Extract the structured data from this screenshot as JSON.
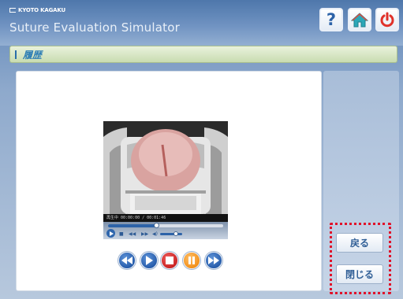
{
  "header": {
    "brand": "KYOTO KAGAKU",
    "title": "Suture Evaluation Simulator",
    "help_label": "?"
  },
  "section": {
    "title": "履歴"
  },
  "video": {
    "status": "再生中 00:00:00 / 00:01:46"
  },
  "playback": {
    "progress": 0.42,
    "volume": 0.7
  },
  "side_buttons": {
    "back_label": "戻る",
    "close_label": "閉じる"
  },
  "icons": {
    "help": "help-icon",
    "home": "home-icon",
    "power": "power-icon",
    "rewind": "rewind-icon",
    "play": "play-icon",
    "stop": "stop-icon",
    "pause": "pause-icon",
    "fast_forward": "fast-forward-icon"
  },
  "colors": {
    "accent_blue": "#2d63a8",
    "stop_red": "#c41c1c",
    "pause_orange": "#f08a10",
    "highlight_red": "#e0122a"
  }
}
